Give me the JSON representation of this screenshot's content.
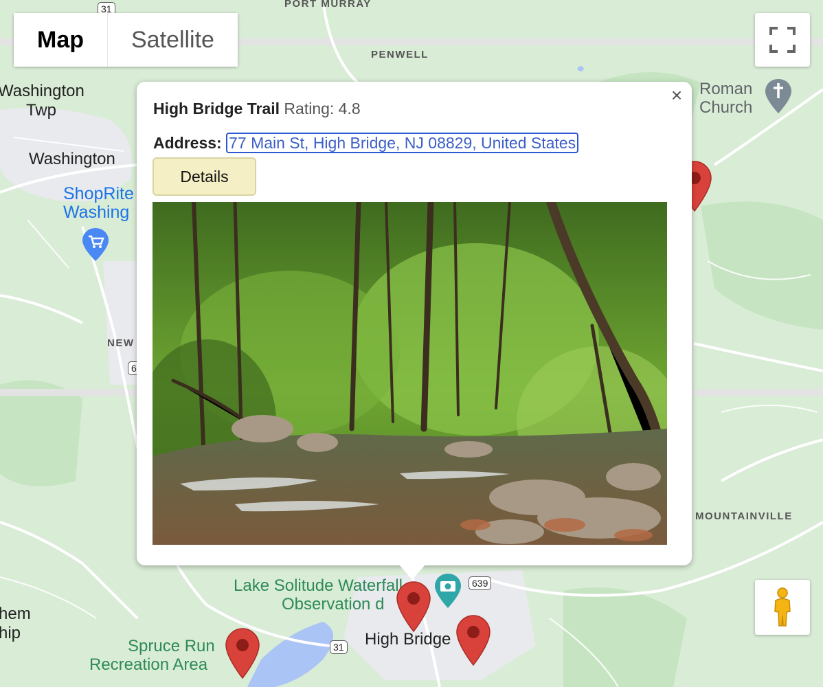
{
  "map_type": {
    "map_label": "Map",
    "satellite_label": "Satellite",
    "selected": "Map"
  },
  "controls": {
    "fullscreen_icon": "fullscreen-icon",
    "pegman_icon": "pegman-icon"
  },
  "map_labels": {
    "port_murray": "PORT MURRAY",
    "penwell": "PENWELL",
    "washington_twp_line1": "Washington",
    "washington_twp_line2": "Twp",
    "washington": "Washington",
    "shoprite_line1": "ShopRite",
    "shoprite_line2": "Washing",
    "new": "NEW",
    "roman_line1": "Roman",
    "roman_line2": "Church",
    "mountainville": "MOUNTAINVILLE",
    "lake_solitude_line1": "Lake Solitude Waterfall",
    "lake_solitude_line2": "Observation d",
    "high_bridge": "High Bridge",
    "spruce_run_line1": "Spruce Run",
    "spruce_run_line2": "Recreation Area",
    "bethlehem_line1": "hem",
    "bethlehem_line2": "hip"
  },
  "route_shields": {
    "r31_top": "31",
    "r639": "639",
    "r31_bottom": "31",
    "r6": "6"
  },
  "popup": {
    "name": "High Bridge Trail",
    "rating_label": "Rating: 4.8",
    "address_label": "Address:",
    "address": "77 Main St, High Bridge, NJ 08829, United States",
    "details_label": "Details",
    "close_icon": "close-icon",
    "photo_subject": "forest stream with rocks and green trees"
  },
  "colors": {
    "map_background": "#d9ecd6",
    "road": "#ffffff",
    "water": "#aac4f5",
    "marker": "#d9423a",
    "details_button": "#f4efc4",
    "link": "#3b5fc7"
  }
}
